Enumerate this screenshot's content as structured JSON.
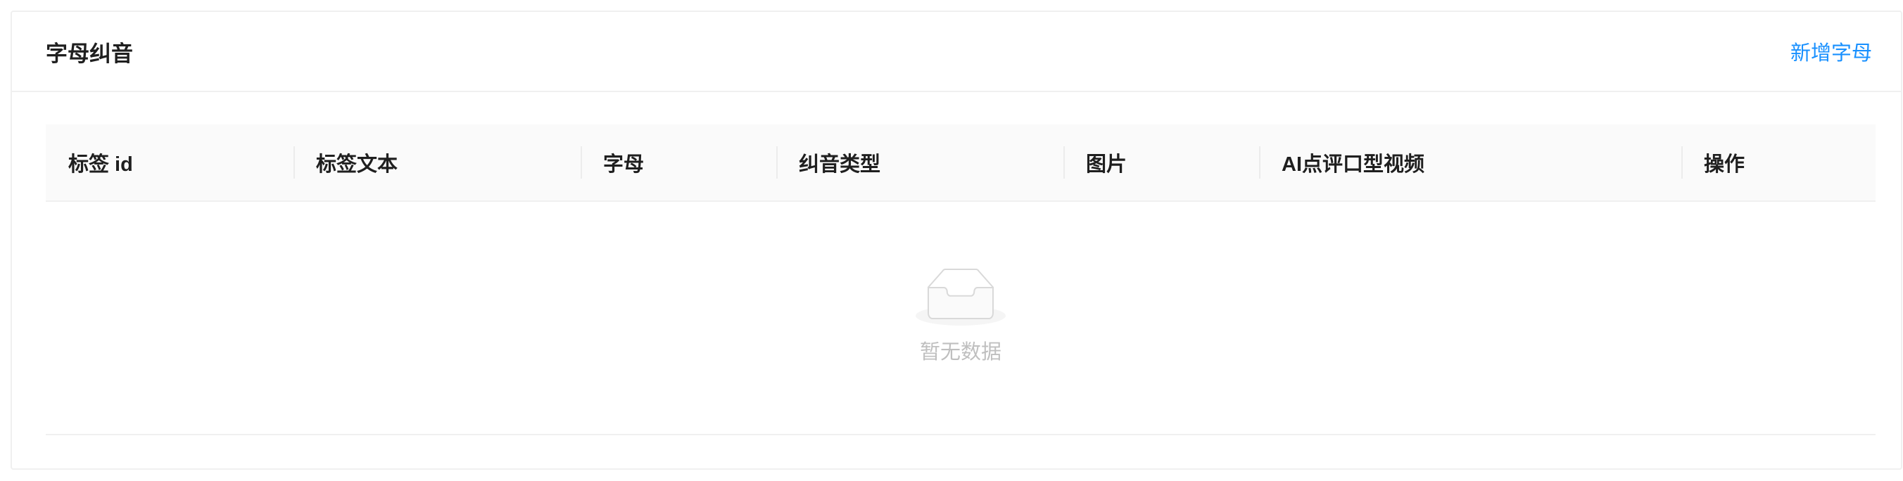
{
  "card": {
    "title": "字母纠音",
    "add_button_label": "新增字母"
  },
  "table": {
    "columns": [
      {
        "key": "tag_id",
        "label": "标签 id"
      },
      {
        "key": "tag_text",
        "label": "标签文本"
      },
      {
        "key": "letter",
        "label": "字母"
      },
      {
        "key": "correction_type",
        "label": "纠音类型"
      },
      {
        "key": "image",
        "label": "图片"
      },
      {
        "key": "ai_video",
        "label": "AI点评口型视频"
      },
      {
        "key": "actions",
        "label": "操作"
      }
    ],
    "rows": [],
    "empty": {
      "icon": "empty-inbox-icon",
      "text": "暂无数据"
    }
  },
  "colors": {
    "accent": "#1890ff",
    "header_bg": "#fafafa",
    "border": "#f0f0f0"
  }
}
